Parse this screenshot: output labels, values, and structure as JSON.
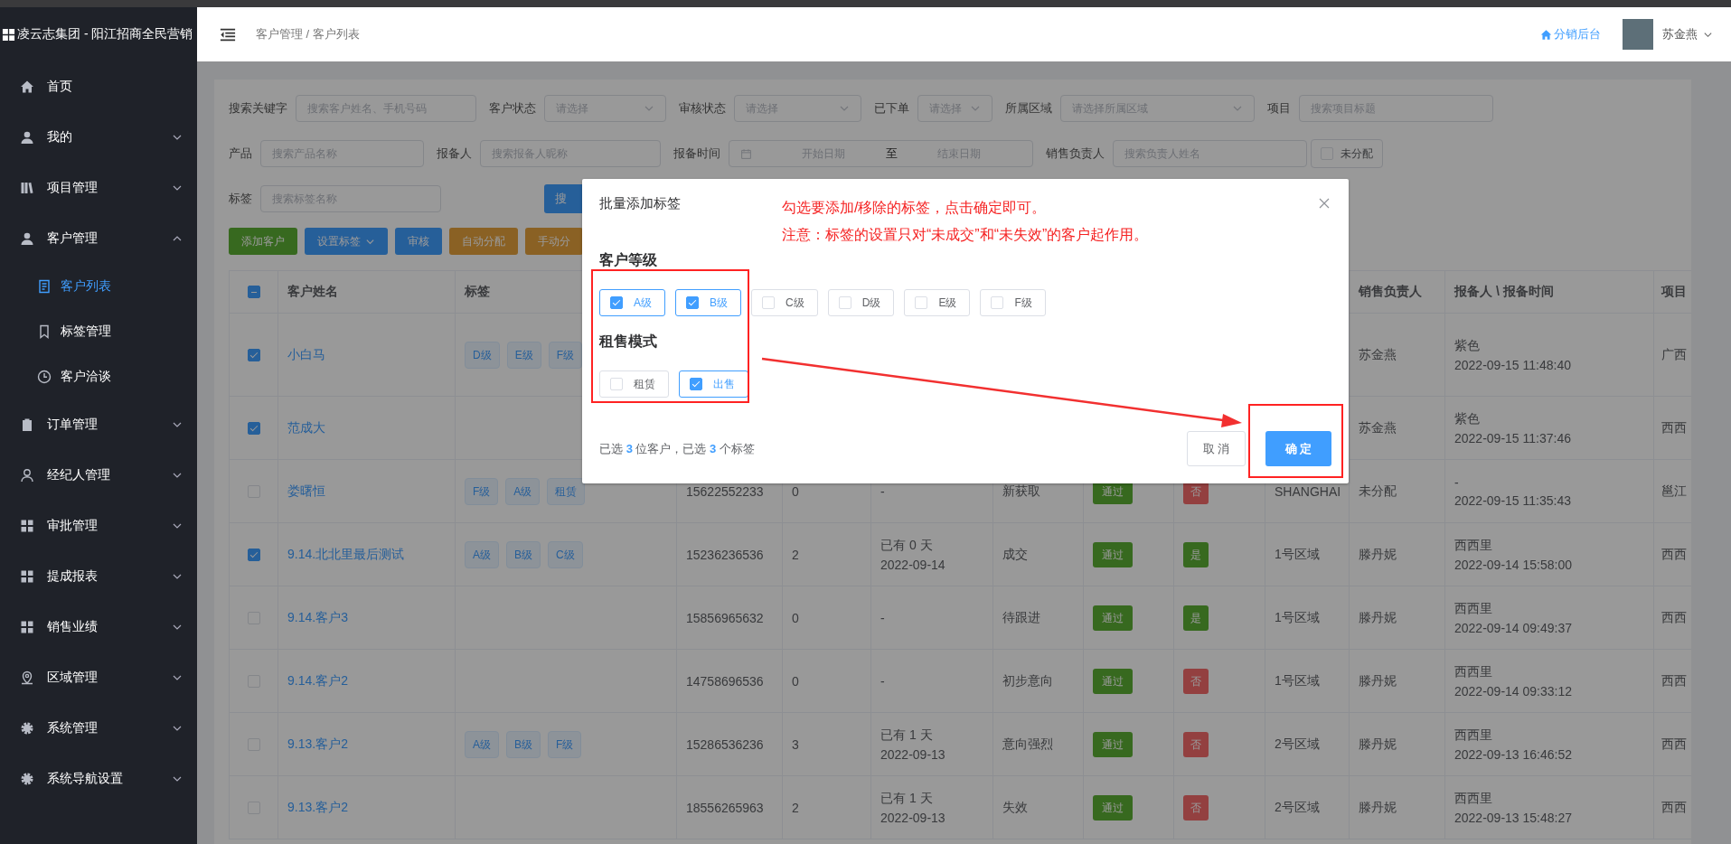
{
  "sidebar": {
    "brand": "凌云志集团 - 阳江招商全民营销",
    "items": [
      {
        "label": "首页",
        "kind": "link",
        "selected": false
      },
      {
        "label": "我的",
        "kind": "submenu",
        "expanded": false,
        "selected": false
      },
      {
        "label": "项目管理",
        "kind": "submenu",
        "expanded": false,
        "selected": false
      },
      {
        "label": "客户管理",
        "kind": "submenu",
        "expanded": true,
        "selected": false,
        "children": [
          {
            "label": "客户列表",
            "selected": true
          },
          {
            "label": "标签管理",
            "selected": false
          },
          {
            "label": "客户洽谈",
            "selected": false
          }
        ]
      },
      {
        "label": "订单管理",
        "kind": "submenu",
        "expanded": false,
        "selected": false
      },
      {
        "label": "经纪人管理",
        "kind": "submenu",
        "expanded": false,
        "selected": false
      },
      {
        "label": "审批管理",
        "kind": "submenu",
        "expanded": false,
        "selected": false
      },
      {
        "label": "提成报表",
        "kind": "submenu",
        "expanded": false,
        "selected": false
      },
      {
        "label": "销售业绩",
        "kind": "submenu",
        "expanded": false,
        "selected": false
      },
      {
        "label": "区域管理",
        "kind": "submenu",
        "expanded": false,
        "selected": false
      },
      {
        "label": "系统管理",
        "kind": "submenu",
        "expanded": false,
        "selected": false
      },
      {
        "label": "系统导航设置",
        "kind": "submenu",
        "expanded": false,
        "selected": false
      }
    ]
  },
  "header": {
    "breadcrumb": "客户管理 / 客户列表",
    "backend_link": "分销后台",
    "user": "苏金燕"
  },
  "filters": [
    [
      {
        "kind": "input",
        "label": "搜索关键字",
        "placeholder": "搜索客户姓名、手机号码"
      },
      {
        "kind": "select",
        "label": "客户状态",
        "placeholder": "请选择"
      },
      {
        "kind": "select",
        "label": "审核状态",
        "placeholder": "请选择"
      },
      {
        "kind": "select",
        "label": "已下单",
        "placeholder": "请选择"
      },
      {
        "kind": "select",
        "label": "所属区域",
        "placeholder": "请选择所属区域"
      },
      {
        "kind": "input",
        "label": "项目",
        "placeholder": "搜索项目标题"
      }
    ],
    [
      {
        "kind": "input",
        "label": "产品",
        "placeholder": "搜索产品名称"
      },
      {
        "kind": "input",
        "label": "报备人",
        "placeholder": "搜索报备人昵称"
      },
      {
        "kind": "daterange",
        "label": "报备时间",
        "start_placeholder": "开始日期",
        "separator": "至",
        "end_placeholder": "结束日期"
      },
      {
        "kind": "input",
        "label": "销售负责人",
        "placeholder": "搜索负责人姓名"
      },
      {
        "kind": "checkbox",
        "label": "未分配",
        "checked": false
      }
    ],
    [
      {
        "kind": "input",
        "label": "标签",
        "placeholder": "搜索标签名称"
      },
      {
        "kind": "button",
        "label": "搜"
      }
    ]
  ],
  "toolbar": [
    {
      "label": "添加客户",
      "kind": "success"
    },
    {
      "label": "设置标签",
      "kind": "primary",
      "dropdown": true
    },
    {
      "label": "审核",
      "kind": "primary"
    },
    {
      "label": "自动分配",
      "kind": "warning"
    },
    {
      "label": "手动分",
      "kind": "warning"
    }
  ],
  "table": {
    "select_all_indeterminate": true,
    "columns": [
      "客户姓名",
      "标签",
      "销售负责人",
      "报备人 \\ 报备时间",
      "项目"
    ],
    "rows": [
      {
        "selected": true,
        "name": "小白马",
        "tags": [
          "D级",
          "E级",
          "F级"
        ],
        "sales": "苏金燕",
        "reporter": "紫色",
        "report_time": "2022-09-15 11:48:40",
        "project": "广西"
      },
      {
        "selected": true,
        "name": "范成大",
        "tags": [],
        "sales": "苏金燕",
        "reporter": "紫色",
        "report_time": "2022-09-15 11:37:46",
        "project": "西西"
      },
      {
        "selected": false,
        "name": "娄曙恒",
        "tags": [
          "F级",
          "A级",
          "租赁"
        ],
        "phone": "15622552233",
        "count": "0",
        "days": [
          "-"
        ],
        "status": "新获取",
        "audit": "通过",
        "ordered": {
          "text": "否",
          "kind": "no"
        },
        "region": "SHANGHAI",
        "sales": "未分配",
        "reporter": "-",
        "report_time": "2022-09-15 11:35:43",
        "project": "邕江"
      },
      {
        "selected": true,
        "name": "9.14.北北里最后测试",
        "tags": [
          "A级",
          "B级",
          "C级"
        ],
        "phone": "15236236536",
        "count": "2",
        "days": [
          "已有 0 天",
          "2022-09-14"
        ],
        "status": "成交",
        "audit": "通过",
        "ordered": {
          "text": "是",
          "kind": "yes"
        },
        "region": "1号区域",
        "sales": "滕丹妮",
        "reporter": "西西里",
        "report_time": "2022-09-14 15:58:00",
        "project": "西西"
      },
      {
        "selected": false,
        "name": "9.14.客户3",
        "tags": [],
        "phone": "15856965632",
        "count": "0",
        "days": [
          "-"
        ],
        "status": "待跟进",
        "audit": "通过",
        "ordered": {
          "text": "是",
          "kind": "yes"
        },
        "region": "1号区域",
        "sales": "滕丹妮",
        "reporter": "西西里",
        "report_time": "2022-09-14 09:49:37",
        "project": "西西"
      },
      {
        "selected": false,
        "name": "9.14.客户2",
        "tags": [],
        "phone": "14758696536",
        "count": "0",
        "days": [
          "-"
        ],
        "status": "初步意向",
        "audit": "通过",
        "ordered": {
          "text": "否",
          "kind": "no"
        },
        "region": "1号区域",
        "sales": "滕丹妮",
        "reporter": "西西里",
        "report_time": "2022-09-14 09:33:12",
        "project": "西西"
      },
      {
        "selected": false,
        "name": "9.13.客户2",
        "tags": [
          "A级",
          "B级",
          "F级"
        ],
        "phone": "15286536236",
        "count": "3",
        "days": [
          "已有 1 天",
          "2022-09-13"
        ],
        "status": "意向强烈",
        "audit": "通过",
        "ordered": {
          "text": "否",
          "kind": "no"
        },
        "region": "2号区域",
        "sales": "滕丹妮",
        "reporter": "西西里",
        "report_time": "2022-09-13 16:46:52",
        "project": "西西"
      },
      {
        "selected": false,
        "name": "9.13.客户2",
        "tags": [],
        "phone": "18556265963",
        "count": "2",
        "days": [
          "已有 1 天",
          "2022-09-13"
        ],
        "status": "失效",
        "audit": "通过",
        "ordered": {
          "text": "否",
          "kind": "no"
        },
        "region": "2号区域",
        "sales": "滕丹妮",
        "reporter": "西西里",
        "report_time": "2022-09-13 15:48:27",
        "project": "西西"
      }
    ]
  },
  "modal": {
    "title": "批量添加标签",
    "annotation": [
      "勾选要添加/移除的标签，点击确定即可。",
      "注意：标签的设置只对“未成交”和“未失效”的客户起作用。"
    ],
    "groups": [
      {
        "title": "客户等级",
        "options": [
          {
            "label": "A级",
            "checked": true
          },
          {
            "label": "B级",
            "checked": true
          },
          {
            "label": "C级",
            "checked": false
          },
          {
            "label": "D级",
            "checked": false
          },
          {
            "label": "E级",
            "checked": false
          },
          {
            "label": "F级",
            "checked": false
          }
        ]
      },
      {
        "title": "租售模式",
        "options": [
          {
            "label": "租赁",
            "checked": false
          },
          {
            "label": "出售",
            "checked": true
          }
        ]
      }
    ],
    "summary": "已选 **3** 位客户，已选 **3** 个标签",
    "cancel": "取 消",
    "confirm": "确 定"
  }
}
